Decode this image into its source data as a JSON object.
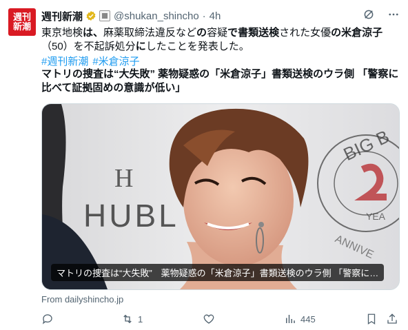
{
  "account": {
    "avatar_text": "週刊新潮",
    "display_name": "週刊新潮",
    "handle": "@shukan_shincho",
    "separator": "·",
    "time": "4h"
  },
  "tweet": {
    "text_parts": [
      {
        "t": "東京地検",
        "b": false
      },
      {
        "t": "は、",
        "b": true
      },
      {
        "t": "麻薬取締法違反など",
        "b": false
      },
      {
        "t": "の",
        "b": true
      },
      {
        "t": "容疑",
        "b": false
      },
      {
        "t": "で",
        "b": true
      },
      {
        "t": "書類送検",
        "b": true
      },
      {
        "t": "された女優",
        "b": false
      },
      {
        "t": "の",
        "b": true
      },
      {
        "t": "米倉涼子",
        "b": true
      },
      {
        "t": "（50）を不起訴処分",
        "b": false
      },
      {
        "t": "に",
        "b": true
      },
      {
        "t": "したことを発表した。",
        "b": false
      }
    ],
    "hashtags": [
      "#週刊新潮",
      "#米倉涼子"
    ],
    "headline": "マトリの捜査は“大失敗” 薬物疑惑の「米倉涼子」書類送検のウラ側 「警察に比べて証拠固めの意識が低い」"
  },
  "card": {
    "overlay_title": "マトリの捜査は“大失敗”　薬物疑惑の「米倉涼子」書類送検のウラ側 「警察に…",
    "bg_text_left": "H",
    "bg_text_brand": "HUBL",
    "bg_text_ring": "BIG B",
    "bg_text_ring2": "ANNIVE",
    "bg_text_year": "YEA",
    "from_label": "From dailyshincho.jp"
  },
  "actions": {
    "reply_count": "",
    "retweet_count": "1",
    "like_count": "",
    "views_count": "445"
  },
  "colors": {
    "brand_red": "#d91a23",
    "link_blue": "#1d9bf0",
    "muted": "#536471",
    "verified_gold": "#e2b719"
  },
  "icons": {
    "verified": "verified-badge-icon",
    "affiliate": "affiliate-badge-icon",
    "grok": "grok-icon",
    "more": "more-icon",
    "reply": "reply-icon",
    "retweet": "retweet-icon",
    "like": "heart-icon",
    "views": "views-icon",
    "bookmark": "bookmark-icon",
    "share": "share-icon"
  }
}
